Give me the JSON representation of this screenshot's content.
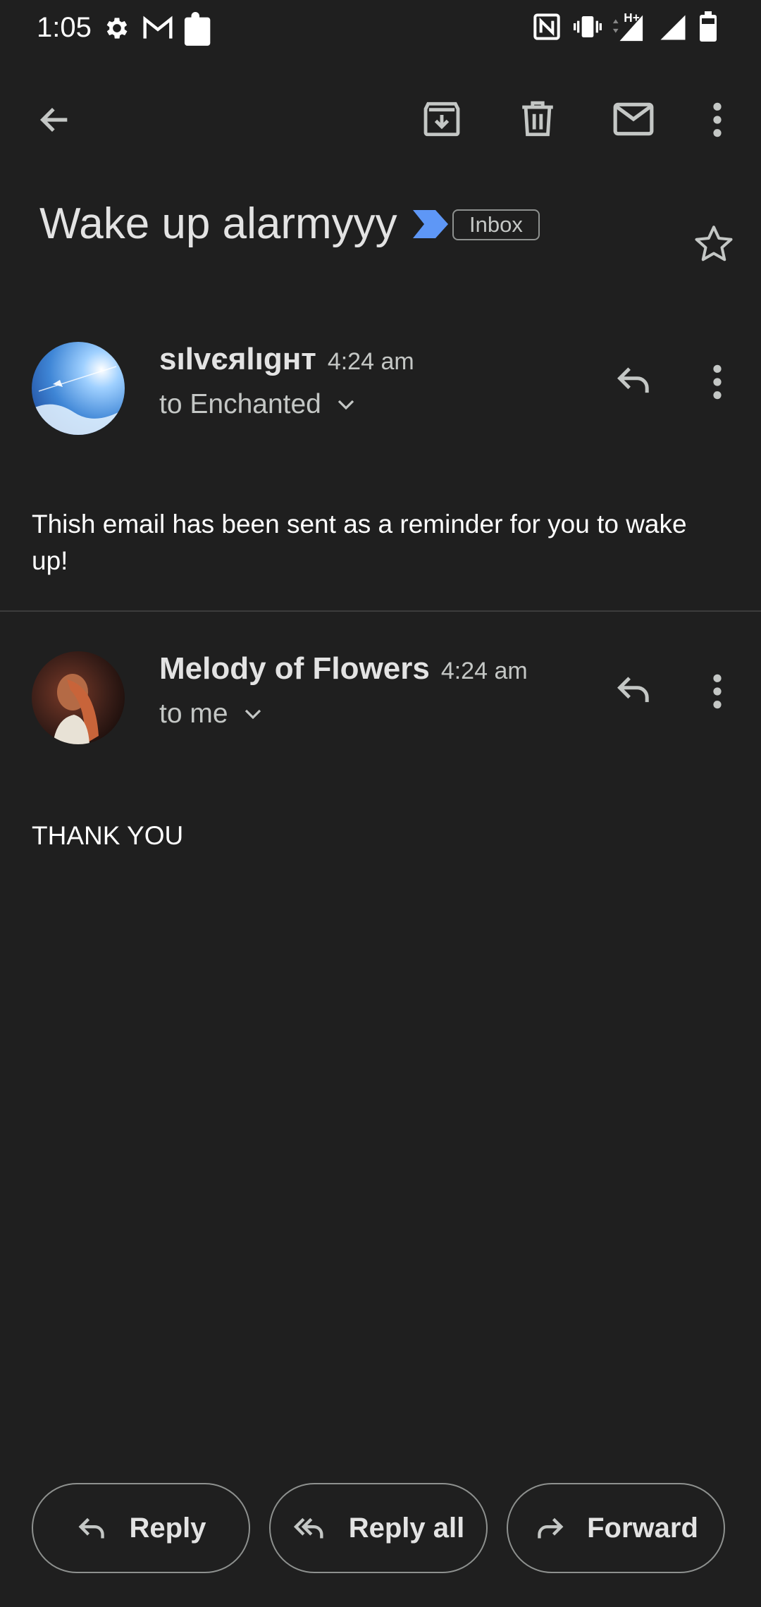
{
  "status_bar": {
    "time": "1:05",
    "left_icons": [
      "settings-icon",
      "gmail-icon",
      "puzzle-icon"
    ],
    "right_icons": [
      "nfc-icon",
      "vibrate-icon",
      "h-plus-signal-icon",
      "signal-icon",
      "battery-icon"
    ]
  },
  "toolbar": {
    "icons": [
      "back-arrow-icon",
      "archive-icon",
      "delete-icon",
      "mark-unread-icon",
      "more-vert-icon"
    ]
  },
  "subject": {
    "title": "Wake up alarmyyy",
    "label": "Inbox",
    "important_marker_color": "#5e97f6"
  },
  "messages": [
    {
      "sender": "sılvєяlıgнт",
      "time": "4:24 am",
      "recipient": "to Enchanted",
      "body": "Thish email has been sent as a reminder for you to wake up!"
    },
    {
      "sender": "Melody of Flowers",
      "time": "4:24 am",
      "recipient": "to me",
      "body": "THANK YOU"
    }
  ],
  "actions": {
    "reply": "Reply",
    "reply_all": "Reply all",
    "forward": "Forward"
  },
  "colors": {
    "background": "#1f1f1f",
    "accent": "#5e97f6"
  }
}
